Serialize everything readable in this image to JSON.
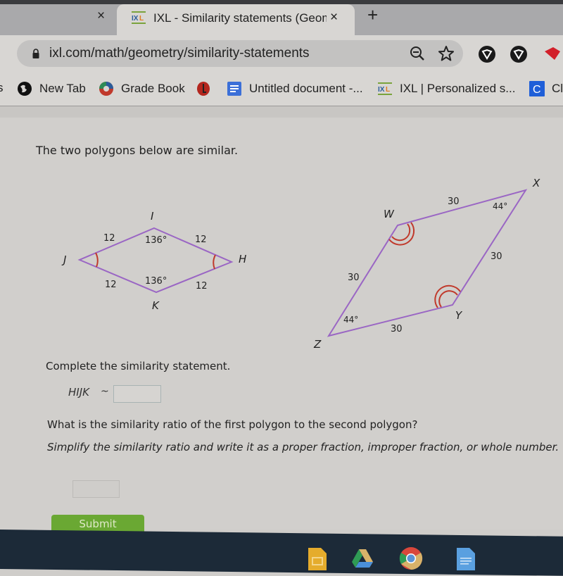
{
  "browser": {
    "tabs": [
      {
        "title": "",
        "close_label": "×"
      },
      {
        "title": "IXL - Similarity statements (Geom",
        "close_label": "×",
        "active": true,
        "favicon": "ixl-icon"
      }
    ],
    "new_tab_label": "+",
    "url": "ixl.com/math/geometry/similarity-statements",
    "toolbar_icons": [
      "zoom-out-icon",
      "bookmark-star-icon",
      "extension-shield-icon",
      "extension-shield-icon",
      "extension-red-icon"
    ]
  },
  "bookmarks": [
    {
      "label": "New Tab",
      "icon": "globe-icon"
    },
    {
      "label": "Grade Book",
      "icon": "gradebook-icon"
    },
    {
      "label": "",
      "icon": "red-logo-icon"
    },
    {
      "label": "Untitled document -...",
      "icon": "google-docs-icon"
    },
    {
      "label": "IXL | Personalized s...",
      "icon": "ixl-icon"
    },
    {
      "label": "Cl",
      "icon": "c-app-icon"
    }
  ],
  "problem": {
    "intro": "The two polygons below are similar.",
    "polygon1": {
      "vertices": {
        "I": "I",
        "H": "H",
        "K": "K",
        "J": "J"
      },
      "sides": [
        "12",
        "12",
        "12",
        "12"
      ],
      "angles": {
        "I": "136°",
        "K": "136°"
      }
    },
    "polygon2": {
      "vertices": {
        "W": "W",
        "X": "X",
        "Y": "Y",
        "Z": "Z"
      },
      "sides": [
        "30",
        "30",
        "30",
        "30"
      ],
      "angles": {
        "X": "44°",
        "Z": "44°"
      }
    },
    "q1": "Complete the similarity statement.",
    "statement_prefix": "HIJK",
    "similar_symbol": "~",
    "answer1_value": "",
    "q2": "What is the similarity ratio of the first polygon to the second polygon?",
    "q3": "Simplify the similarity ratio and write it as a proper fraction, improper fraction, or whole number.",
    "answer2_value": "",
    "submit_label": "Submit"
  },
  "colors": {
    "polygon_stroke": "#9a66c4",
    "angle_mark": "#c0392b",
    "submit_green": "#6aa833"
  },
  "taskbar": {
    "apps": [
      "google-slides-icon",
      "google-drive-icon",
      "chrome-icon",
      "google-docs-icon"
    ]
  }
}
